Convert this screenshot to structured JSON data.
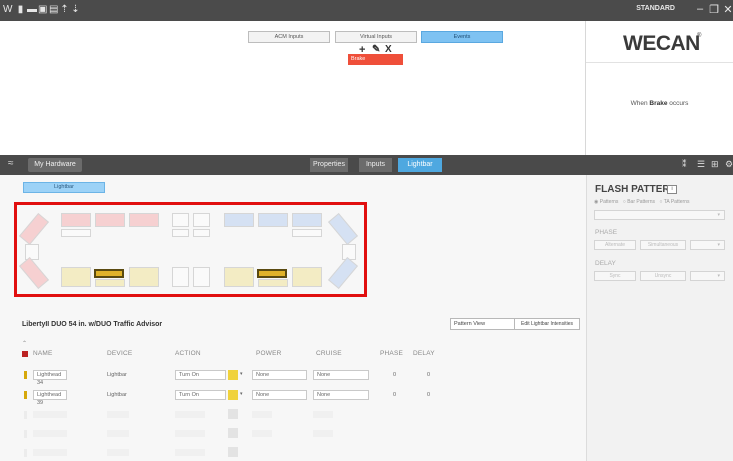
{
  "app": {
    "mode": "STANDARD",
    "logo": "WECAN"
  },
  "top_tabs": [
    {
      "label": "ACM Inputs"
    },
    {
      "label": "Virtual Inputs"
    },
    {
      "label": "Events"
    }
  ],
  "event_chip": "Brake",
  "event_description": {
    "prefix": "When ",
    "event": "Brake",
    "suffix": " occurs"
  },
  "hardware_bar": {
    "my_hardware": "My Hardware",
    "tabs": [
      {
        "label": "Properties"
      },
      {
        "label": "Inputs"
      },
      {
        "label": "Lightbar"
      }
    ]
  },
  "lightbar_chip": "Lightbar",
  "device_info": {
    "title": "LibertyII DUO 54 in. w/DUO Traffic Advisor",
    "view_select": "Pattern View",
    "edit_button": "Edit Lightbar Intensities"
  },
  "table": {
    "headers": [
      "NAME",
      "DEVICE",
      "ACTION",
      "POWER",
      "CRUISE",
      "PHASE",
      "DELAY"
    ],
    "rows": [
      {
        "name": "Lighthead 34",
        "device": "Lightbar",
        "action": "Turn On",
        "power": "None",
        "cruise": "None",
        "phase": "0",
        "delay": "0"
      },
      {
        "name": "Lighthead 39",
        "device": "Lightbar",
        "action": "Turn On",
        "power": "None",
        "cruise": "None",
        "phase": "0",
        "delay": "0"
      }
    ]
  },
  "flash_pattern": {
    "title": "FLASH PATTERN",
    "info": "i",
    "radios": [
      "Patterns",
      "Bar Patterns",
      "TA Patterns"
    ],
    "phase_label": "PHASE",
    "phase_options": [
      "Alternate",
      "Simultaneous"
    ],
    "delay_label": "DELAY",
    "delay_options": [
      "Sync",
      "Unsync"
    ]
  },
  "colors": {
    "accent_blue": "#4ea8e0",
    "event_red": "#ef4f3a",
    "highlight_red": "#e10f0f",
    "active_light": "#e0b22a"
  }
}
